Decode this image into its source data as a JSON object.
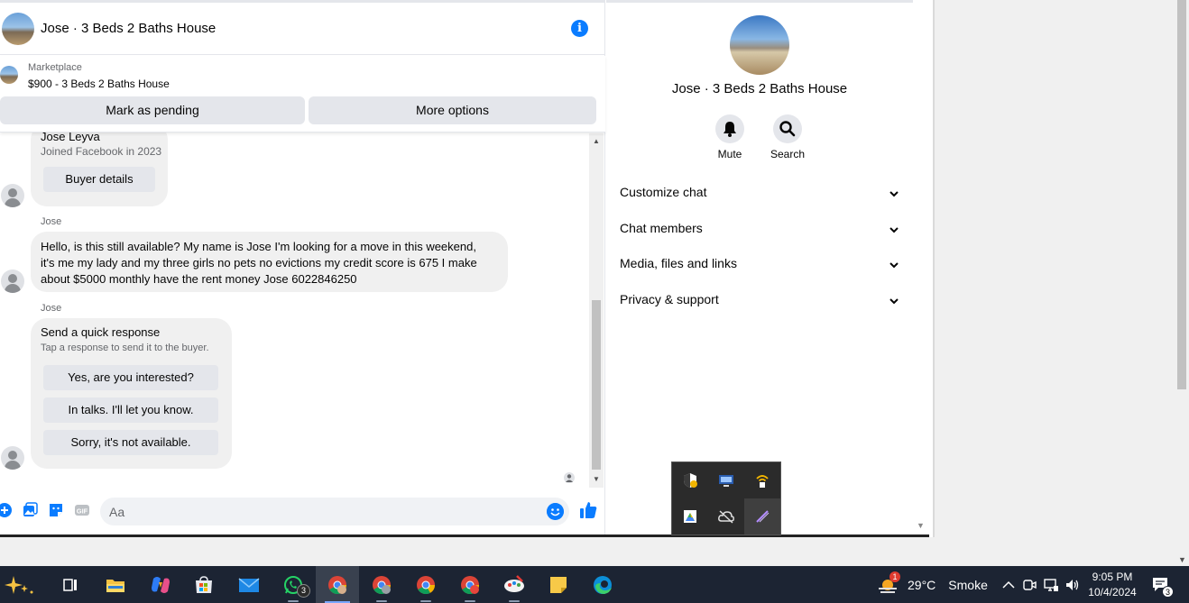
{
  "chat": {
    "title": "Jose · 3 Beds 2 Baths House",
    "listing": {
      "label": "Marketplace",
      "price_title": "$900 - 3 Beds 2 Baths House",
      "buttons": {
        "pending": "Mark as pending",
        "more": "More options"
      }
    },
    "profile_card": {
      "name": "Jose Leyva",
      "joined": "Joined Facebook in 2023",
      "button": "Buyer details"
    },
    "messages": [
      {
        "sender": "Jose",
        "lines": [
          "Hello, is this still available? My name is Jose I'm looking for a move in this weekend,",
          "it's me my lady and my three girls no pets no evictions my credit score is 675 I make",
          "about $5000 monthly have the rent money Jose 6022846250"
        ]
      }
    ],
    "quick_response": {
      "sender": "Jose",
      "title": "Send a quick response",
      "subtitle": "Tap a response to send it to the buyer.",
      "options": [
        "Yes, are you interested?",
        "In talks. I'll let you know.",
        "Sorry, it's not available."
      ]
    },
    "composer": {
      "placeholder": "Aa"
    },
    "accent": "#0a7cff"
  },
  "info_panel": {
    "name": "Jose · 3 Beds 2 Baths House",
    "actions": [
      {
        "label": "Mute",
        "icon": "bell-icon"
      },
      {
        "label": "Search",
        "icon": "search-icon"
      }
    ],
    "sections": [
      "Customize chat",
      "Chat members",
      "Media, files and links",
      "Privacy & support"
    ]
  },
  "taskbar": {
    "whatsapp_badge": "3",
    "weather": {
      "badge": "1",
      "temp": "29°C",
      "condition": "Smoke"
    },
    "clock": {
      "time": "9:05 PM",
      "date": "10/4/2024"
    },
    "notification_count": "3"
  }
}
